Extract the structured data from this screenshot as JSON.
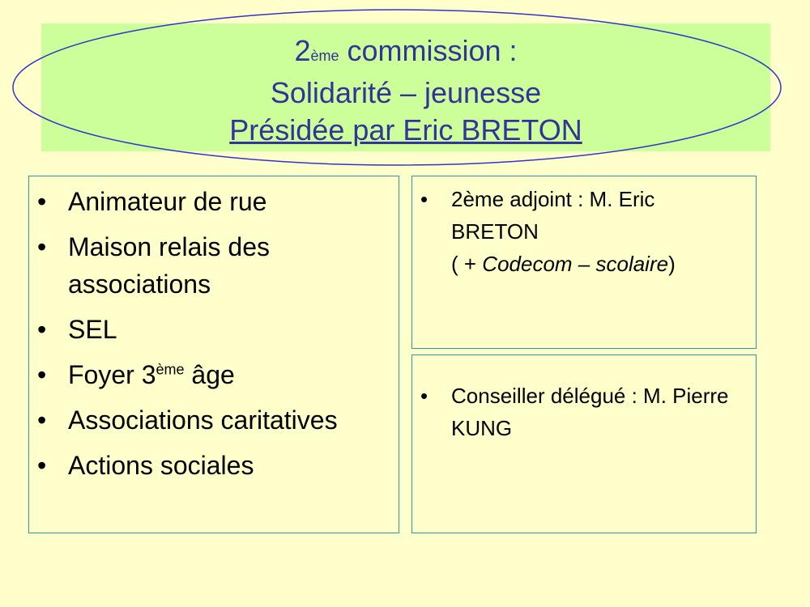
{
  "title": {
    "line1_number": "2",
    "line1_sup": "ème",
    "line1_rest": " commission :",
    "line2": "Solidarité – jeunesse",
    "line3": "Présidée par Eric BRETON"
  },
  "left_box": {
    "items": [
      {
        "text": "Animateur de rue"
      },
      {
        "text": "Maison relais des associations"
      },
      {
        "text": "SEL"
      },
      {
        "pre": "Foyer 3",
        "sup": "ème",
        "post": " âge"
      },
      {
        "text": "Associations caritatives"
      },
      {
        "text": "Actions sociales"
      }
    ]
  },
  "right_top_box": {
    "line1": "2ème adjoint : M. Eric BRETON",
    "paren_open": "( + ",
    "paren_italic": "Codecom – scolaire",
    "paren_close": ")"
  },
  "right_bottom_box": {
    "line1": "Conseiller délégué : M. Pierre KUNG"
  },
  "colors": {
    "background": "#ffffcc",
    "title_band": "#ccff99",
    "title_text": "#333399",
    "oval_stroke": "#3333cc",
    "box_border": "#2a9d9d"
  }
}
